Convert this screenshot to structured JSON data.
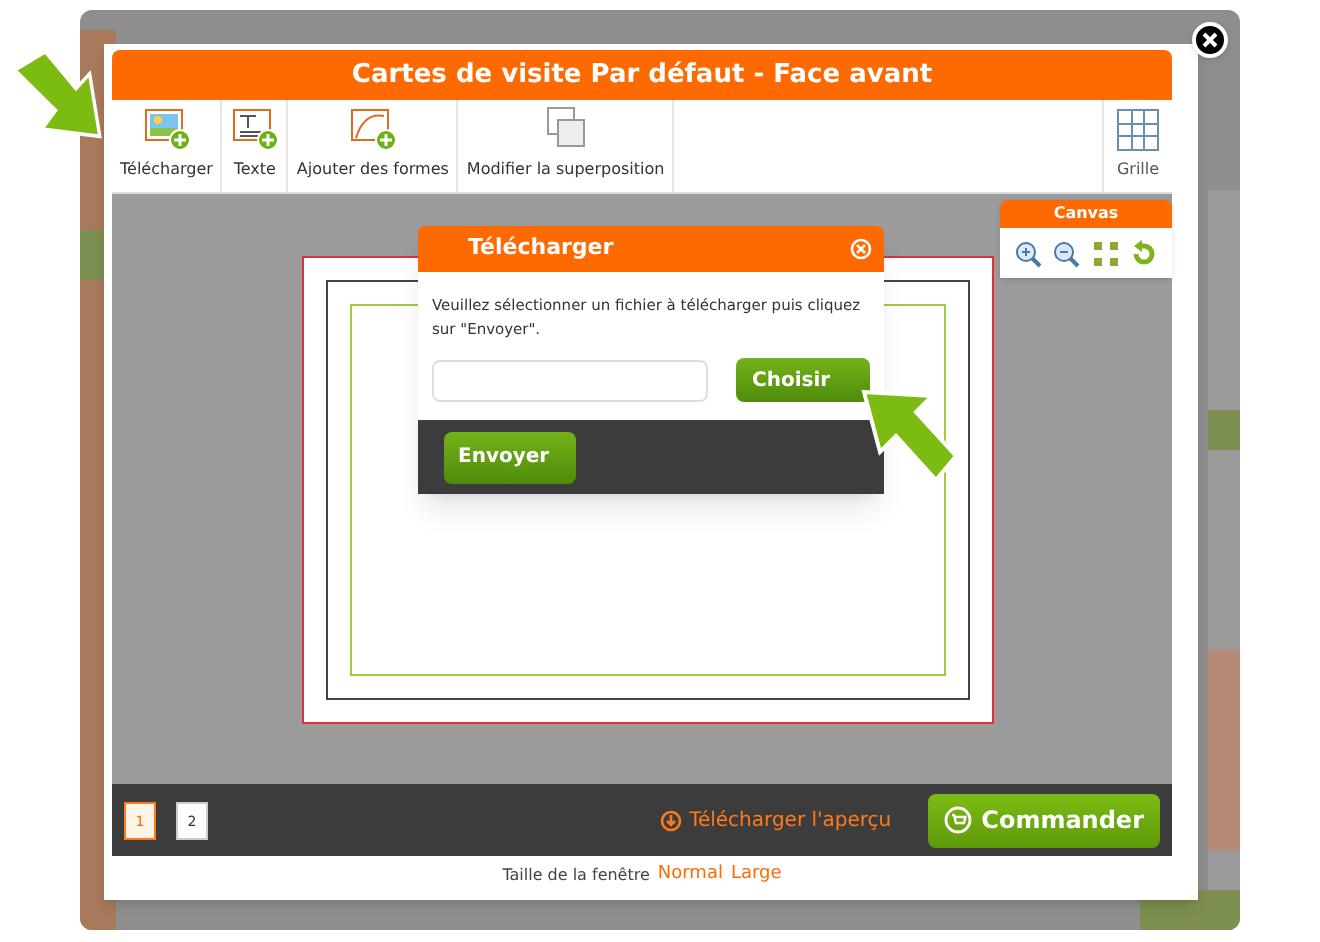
{
  "window": {
    "title": "Cartes de visite Par défaut - Face avant"
  },
  "toolbar": [
    {
      "label": "Télécharger",
      "kind": "image"
    },
    {
      "label": "Texte",
      "kind": "text"
    },
    {
      "label": "Ajouter des formes",
      "kind": "shapes"
    },
    {
      "label": "Modifier la superposition",
      "kind": "layers"
    }
  ],
  "grid_button": {
    "label": "Grille"
  },
  "canvas_panel": {
    "title": "Canvas",
    "tools": [
      {
        "kind": "zoom-in"
      },
      {
        "kind": "zoom-out"
      },
      {
        "kind": "fit"
      },
      {
        "kind": "reset"
      }
    ]
  },
  "dialog": {
    "title": "Télécharger",
    "message": "Veuillez sélectionner un fichier à télécharger puis cliquez sur \"Envoyer\".",
    "choose_button": "Choisir",
    "send_button": "Envoyer"
  },
  "pages": [
    {
      "label": "1",
      "selected": true
    },
    {
      "label": "2",
      "selected": false
    }
  ],
  "preview_link": "Télécharger l'aperçu",
  "order_button": "Commander",
  "footer": {
    "label": "Taille de la fenêtre",
    "sizes": [
      "Normal",
      "Large"
    ]
  }
}
